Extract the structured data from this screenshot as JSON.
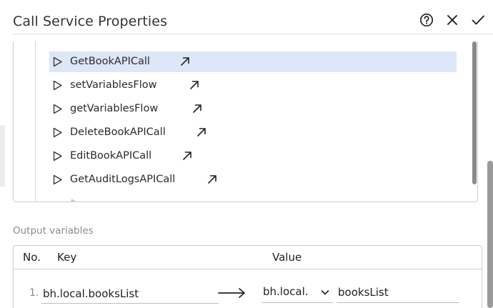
{
  "dialog": {
    "title": "Call Service Properties",
    "help_icon": "help-circle-icon",
    "close_icon": "close-icon",
    "confirm_icon": "check-icon"
  },
  "flows": [
    {
      "label": "GetBookAPICall",
      "selected": true
    },
    {
      "label": "setVariablesFlow",
      "selected": false
    },
    {
      "label": "getVariablesFlow",
      "selected": false
    },
    {
      "label": "DeleteBookAPICall",
      "selected": false
    },
    {
      "label": "EditBookAPICall",
      "selected": false
    },
    {
      "label": "GetAuditLogsAPICall",
      "selected": false
    }
  ],
  "flow_icons": {
    "run": "play-icon",
    "open": "arrow-up-right-icon"
  },
  "output": {
    "section_label": "Output variables",
    "headers": {
      "no": "No.",
      "key": "Key",
      "value": "Value"
    },
    "rows": [
      {
        "number": "1.",
        "key": "bh.local.booksList",
        "scope": "bh.local.",
        "name": "booksList"
      }
    ]
  },
  "colors": {
    "selected_row": "#dde7f7",
    "border": "#cfcfcf",
    "muted_text": "#8a8a8a"
  }
}
